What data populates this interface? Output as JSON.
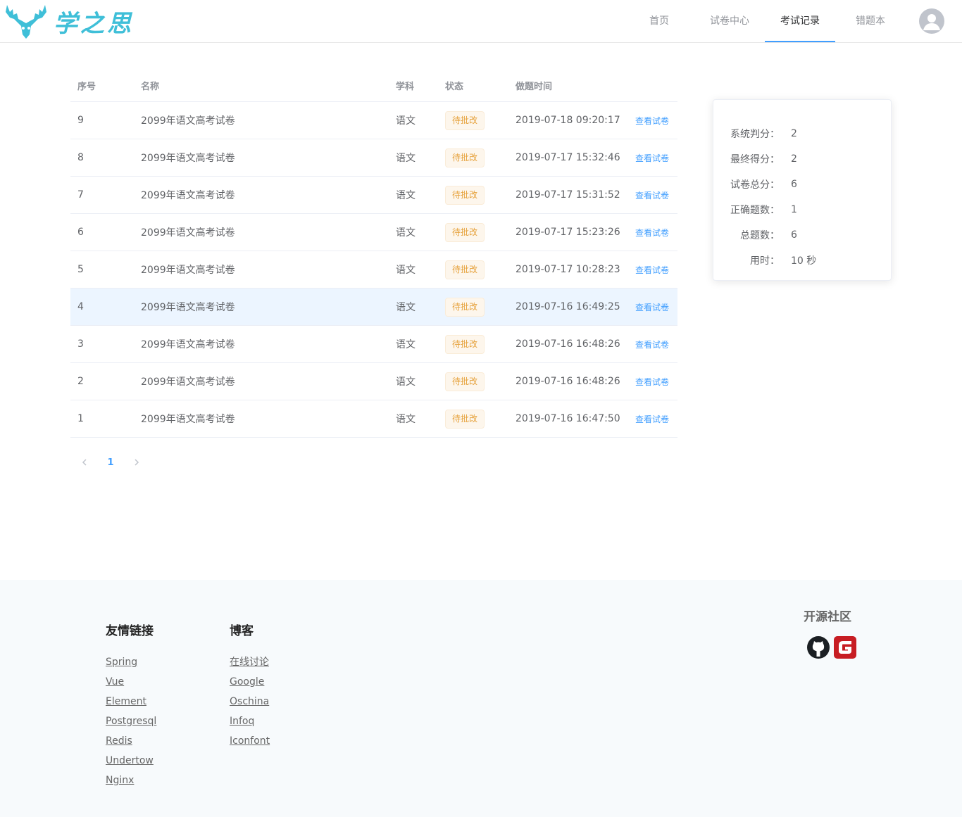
{
  "header": {
    "logo_text": "学之思",
    "nav": [
      {
        "label": "首页",
        "active": false
      },
      {
        "label": "试卷中心",
        "active": false
      },
      {
        "label": "考试记录",
        "active": true
      },
      {
        "label": "错题本",
        "active": false
      }
    ]
  },
  "table": {
    "columns": [
      "序号",
      "名称",
      "学科",
      "状态",
      "做题时间"
    ],
    "rows": [
      {
        "idx": "9",
        "name": "2099年语文高考试卷",
        "subject": "语文",
        "status": "待批改",
        "time": "2019-07-18 09:20:17",
        "action": "查看试卷"
      },
      {
        "idx": "8",
        "name": "2099年语文高考试卷",
        "subject": "语文",
        "status": "待批改",
        "time": "2019-07-17 15:32:46",
        "action": "查看试卷"
      },
      {
        "idx": "7",
        "name": "2099年语文高考试卷",
        "subject": "语文",
        "status": "待批改",
        "time": "2019-07-17 15:31:52",
        "action": "查看试卷"
      },
      {
        "idx": "6",
        "name": "2099年语文高考试卷",
        "subject": "语文",
        "status": "待批改",
        "time": "2019-07-17 15:23:26",
        "action": "查看试卷"
      },
      {
        "idx": "5",
        "name": "2099年语文高考试卷",
        "subject": "语文",
        "status": "待批改",
        "time": "2019-07-17 10:28:23",
        "action": "查看试卷"
      },
      {
        "idx": "4",
        "name": "2099年语文高考试卷",
        "subject": "语文",
        "status": "待批改",
        "time": "2019-07-16 16:49:25",
        "action": "查看试卷"
      },
      {
        "idx": "3",
        "name": "2099年语文高考试卷",
        "subject": "语文",
        "status": "待批改",
        "time": "2019-07-16 16:48:26",
        "action": "查看试卷"
      },
      {
        "idx": "2",
        "name": "2099年语文高考试卷",
        "subject": "语文",
        "status": "待批改",
        "time": "2019-07-16 16:48:26",
        "action": "查看试卷"
      },
      {
        "idx": "1",
        "name": "2099年语文高考试卷",
        "subject": "语文",
        "status": "待批改",
        "time": "2019-07-16 16:47:50",
        "action": "查看试卷"
      }
    ]
  },
  "pagination": {
    "current": "1",
    "prev_icon": "chevron-left-icon",
    "next_icon": "chevron-right-icon"
  },
  "stats": [
    {
      "label": "系统判分：",
      "value": "2"
    },
    {
      "label": "最终得分：",
      "value": "2"
    },
    {
      "label": "试卷总分：",
      "value": "6"
    },
    {
      "label": "正确题数：",
      "value": "1"
    },
    {
      "label": "总题数：",
      "value": "6"
    },
    {
      "label": "用时：",
      "value": "10 秒"
    }
  ],
  "footer": {
    "links_title": "友情链接",
    "links": [
      "Spring",
      "Vue",
      "Element",
      "Postgresql",
      "Redis",
      "Undertow",
      "Nginx"
    ],
    "blog_title": "博客",
    "blogs": [
      "在线讨论",
      "Google",
      "Oschina",
      "Infoq",
      "Iconfont"
    ],
    "community_title": "开源社区"
  },
  "colors": {
    "accent": "#409eff",
    "warning": "#e6a23c",
    "logo": "#3fbfd8",
    "gitee": "#c71d23"
  }
}
